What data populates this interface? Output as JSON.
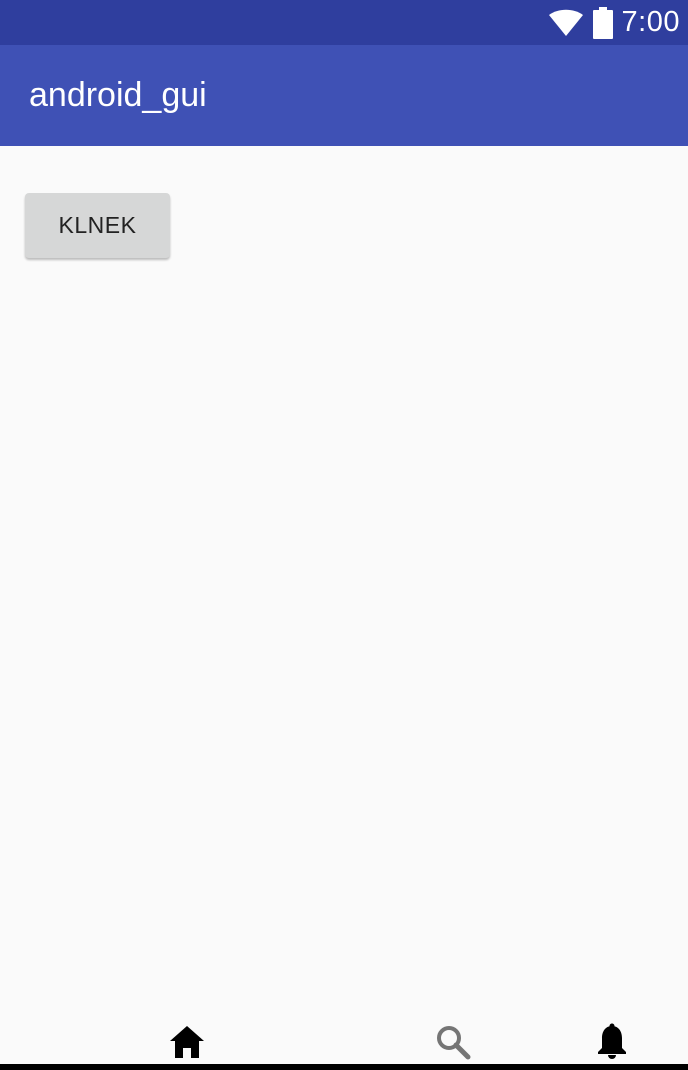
{
  "status_bar": {
    "time": "7:00",
    "icons": [
      "wifi-icon",
      "battery-icon"
    ]
  },
  "app_bar": {
    "title": "android_gui"
  },
  "main": {
    "button_label": "KLNEK"
  },
  "bottom_nav": {
    "items": [
      {
        "icon": "home-icon",
        "color": "#000000"
      },
      {
        "icon": "search-icon",
        "color": "#757575"
      },
      {
        "icon": "bell-icon",
        "color": "#000000"
      }
    ]
  },
  "colors": {
    "status_bar": "#2f3e9e",
    "app_bar": "#3f51b5",
    "background": "#fafafa",
    "button": "#d6d7d7"
  }
}
